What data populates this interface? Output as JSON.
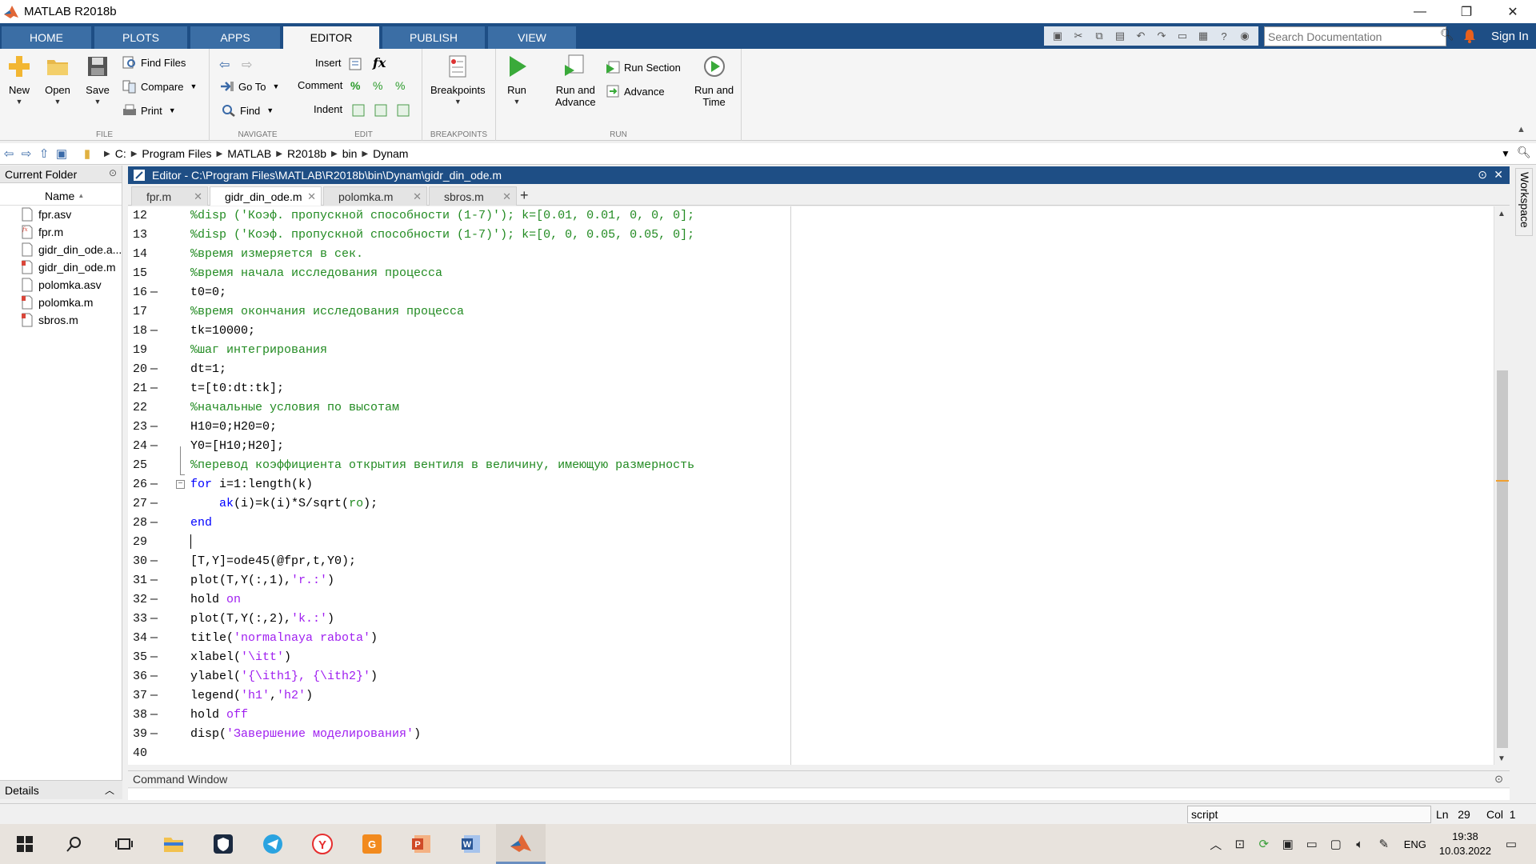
{
  "window": {
    "title": "MATLAB R2018b",
    "minimize_icon": "—",
    "restore_icon": "❐",
    "close_icon": "✕"
  },
  "ribbon_tabs": [
    {
      "label": "HOME"
    },
    {
      "label": "PLOTS"
    },
    {
      "label": "APPS"
    },
    {
      "label": "EDITOR",
      "active": true
    },
    {
      "label": "PUBLISH"
    },
    {
      "label": "VIEW"
    }
  ],
  "search": {
    "placeholder": "Search Documentation"
  },
  "sign_in": "Sign In",
  "ribbon": {
    "file": {
      "label": "FILE",
      "new": "New",
      "open": "Open",
      "save": "Save",
      "find_files": "Find Files",
      "compare": "Compare",
      "print": "Print"
    },
    "navigate": {
      "label": "NAVIGATE",
      "go_to": "Go To",
      "find": "Find"
    },
    "edit": {
      "label": "EDIT",
      "insert": "Insert",
      "comment": "Comment",
      "indent": "Indent",
      "fx": "fx"
    },
    "breakpoints": {
      "label": "BREAKPOINTS",
      "breakpoints": "Breakpoints"
    },
    "run": {
      "label": "RUN",
      "run": "Run",
      "run_and_advance_1": "Run and",
      "run_and_advance_2": "Advance",
      "run_section": "Run Section",
      "advance": "Advance",
      "run_and_time_1": "Run and",
      "run_and_time_2": "Time"
    }
  },
  "address": {
    "crumbs": [
      "C:",
      "Program Files",
      "MATLAB",
      "R2018b",
      "bin",
      "Dynam"
    ]
  },
  "current_folder": {
    "title": "Current Folder",
    "name_header": "Name",
    "sort_indicator": "▲",
    "files": [
      {
        "name": "fpr.asv",
        "icon": "asv-file-icon"
      },
      {
        "name": "fpr.m",
        "icon": "function-file-icon"
      },
      {
        "name": "gidr_din_ode.a...",
        "icon": "asv-file-icon"
      },
      {
        "name": "gidr_din_ode.m",
        "icon": "script-file-icon"
      },
      {
        "name": "polomka.asv",
        "icon": "asv-file-icon"
      },
      {
        "name": "polomka.m",
        "icon": "script-file-icon"
      },
      {
        "name": "sbros.m",
        "icon": "script-file-icon"
      }
    ],
    "details": "Details"
  },
  "editor": {
    "title": "Editor - C:\\Program Files\\MATLAB\\R2018b\\bin\\Dynam\\gidr_din_ode.m",
    "tabs": [
      {
        "label": "fpr.m"
      },
      {
        "label": "gidr_din_ode.m",
        "active": true
      },
      {
        "label": "polomka.m"
      },
      {
        "label": "sbros.m"
      }
    ],
    "add_tab": "+",
    "lines": [
      {
        "n": "12",
        "dash": false,
        "tokens": [
          {
            "t": "%disp ('Коэф. пропускной способности (1-7)'); k=[0.01, 0.01, 0, 0, 0];",
            "c": "com"
          }
        ]
      },
      {
        "n": "13",
        "dash": false,
        "tokens": [
          {
            "t": "%disp ('Коэф. пропускной способности (1-7)'); k=[0, 0, 0.05, 0.05, 0];",
            "c": "com"
          }
        ]
      },
      {
        "n": "14",
        "dash": false,
        "tokens": [
          {
            "t": "%время измеряется в сек.",
            "c": "com"
          }
        ]
      },
      {
        "n": "15",
        "dash": false,
        "tokens": [
          {
            "t": "%время начала исследования процесса",
            "c": "com"
          }
        ]
      },
      {
        "n": "16",
        "dash": true,
        "tokens": [
          {
            "t": "t0=0;",
            "c": ""
          }
        ]
      },
      {
        "n": "17",
        "dash": false,
        "tokens": [
          {
            "t": "%время окончания исследования процесса",
            "c": "com"
          }
        ]
      },
      {
        "n": "18",
        "dash": true,
        "tokens": [
          {
            "t": "tk=10000;",
            "c": ""
          }
        ]
      },
      {
        "n": "19",
        "dash": false,
        "tokens": [
          {
            "t": "%шаг интегрирования",
            "c": "com"
          }
        ]
      },
      {
        "n": "20",
        "dash": true,
        "tokens": [
          {
            "t": "dt=1;",
            "c": ""
          }
        ]
      },
      {
        "n": "21",
        "dash": true,
        "tokens": [
          {
            "t": "t=[t0:dt:tk];",
            "c": ""
          }
        ]
      },
      {
        "n": "22",
        "dash": false,
        "tokens": [
          {
            "t": "%начальные условия по высотам",
            "c": "com"
          }
        ]
      },
      {
        "n": "23",
        "dash": true,
        "tokens": [
          {
            "t": "H10=0;H20=0;",
            "c": ""
          }
        ]
      },
      {
        "n": "24",
        "dash": true,
        "tokens": [
          {
            "t": "Y0=[H10;H20];",
            "c": ""
          }
        ]
      },
      {
        "n": "25",
        "dash": false,
        "tokens": [
          {
            "t": "%перевод коэффициента открытия вентиля в величину, имеющую размерность",
            "c": "com"
          }
        ]
      },
      {
        "n": "26",
        "dash": true,
        "fold": "−",
        "tokens": [
          {
            "t": "for",
            "c": "kw"
          },
          {
            "t": " i=1:length(k)",
            "c": ""
          }
        ]
      },
      {
        "n": "27",
        "dash": true,
        "tokens": [
          {
            "t": "    ",
            "c": ""
          },
          {
            "t": "ak",
            "c": "kw"
          },
          {
            "t": "(i)=k(i)*S/sqrt(",
            "c": ""
          },
          {
            "t": "ro",
            "c": "com"
          },
          {
            "t": ");",
            "c": ""
          }
        ]
      },
      {
        "n": "28",
        "dash": true,
        "tokens": [
          {
            "t": "end",
            "c": "kw"
          }
        ]
      },
      {
        "n": "29",
        "dash": false,
        "tokens": [
          {
            "t": "",
            "c": ""
          }
        ]
      },
      {
        "n": "30",
        "dash": true,
        "tokens": [
          {
            "t": "[T,Y]=ode45(@fpr,t,Y0);",
            "c": ""
          }
        ]
      },
      {
        "n": "31",
        "dash": true,
        "tokens": [
          {
            "t": "plot(T,Y(:,1),",
            "c": ""
          },
          {
            "t": "'r.:'",
            "c": "str"
          },
          {
            "t": ")",
            "c": ""
          }
        ]
      },
      {
        "n": "32",
        "dash": true,
        "tokens": [
          {
            "t": "hold ",
            "c": ""
          },
          {
            "t": "on",
            "c": "str"
          }
        ]
      },
      {
        "n": "33",
        "dash": true,
        "tokens": [
          {
            "t": "plot(T,Y(:,2),",
            "c": ""
          },
          {
            "t": "'k.:'",
            "c": "str"
          },
          {
            "t": ")",
            "c": ""
          }
        ]
      },
      {
        "n": "34",
        "dash": true,
        "tokens": [
          {
            "t": "title(",
            "c": ""
          },
          {
            "t": "'normalnaya rabota'",
            "c": "str"
          },
          {
            "t": ")",
            "c": ""
          }
        ]
      },
      {
        "n": "35",
        "dash": true,
        "tokens": [
          {
            "t": "xlabel(",
            "c": ""
          },
          {
            "t": "'\\itt'",
            "c": "str"
          },
          {
            "t": ")",
            "c": ""
          }
        ]
      },
      {
        "n": "36",
        "dash": true,
        "tokens": [
          {
            "t": "ylabel(",
            "c": ""
          },
          {
            "t": "'{\\ith1}, {\\ith2}'",
            "c": "str"
          },
          {
            "t": ")",
            "c": ""
          }
        ]
      },
      {
        "n": "37",
        "dash": true,
        "tokens": [
          {
            "t": "legend(",
            "c": ""
          },
          {
            "t": "'h1'",
            "c": "str"
          },
          {
            "t": ",",
            "c": ""
          },
          {
            "t": "'h2'",
            "c": "str"
          },
          {
            "t": ")",
            "c": ""
          }
        ]
      },
      {
        "n": "38",
        "dash": true,
        "tokens": [
          {
            "t": "hold ",
            "c": ""
          },
          {
            "t": "off",
            "c": "str"
          }
        ]
      },
      {
        "n": "39",
        "dash": true,
        "tokens": [
          {
            "t": "disp(",
            "c": ""
          },
          {
            "t": "'Завершение моделирования'",
            "c": "str"
          },
          {
            "t": ")",
            "c": ""
          }
        ]
      },
      {
        "n": "40",
        "dash": false,
        "tokens": [
          {
            "t": "",
            "c": ""
          }
        ]
      }
    ]
  },
  "command_window": {
    "title": "Command Window"
  },
  "workspace_tab": "Workspace",
  "status": {
    "mode": "script",
    "ln_label": "Ln",
    "ln": "29",
    "col_label": "Col",
    "col": "1"
  },
  "taskbar": {
    "lang": "ENG",
    "time": "19:38",
    "date": "10.03.2022"
  },
  "colors": {
    "comment": "#228b22",
    "keyword": "#0000ff",
    "string": "#a020f0",
    "title_blue": "#1e4e85"
  }
}
